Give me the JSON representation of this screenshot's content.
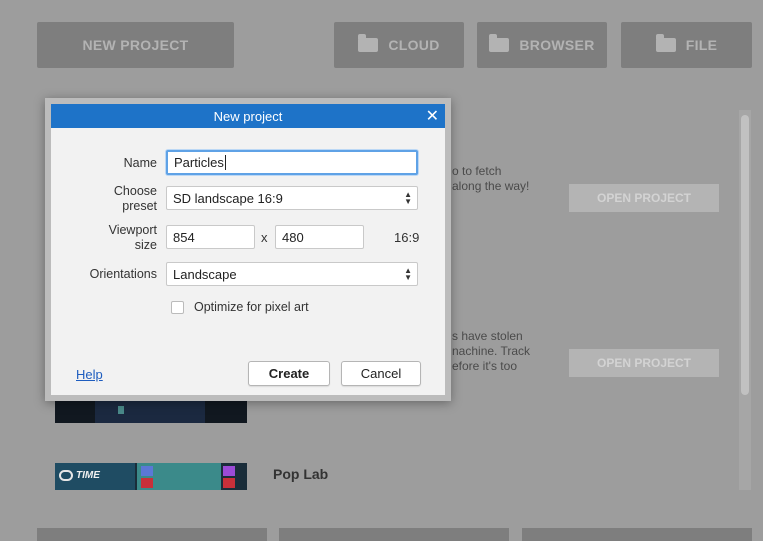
{
  "background": {
    "top_buttons": [
      {
        "label": "NEW PROJECT"
      },
      {
        "label": "CLOUD",
        "icon": "folder-icon"
      },
      {
        "label": "BROWSER",
        "icon": "folder-icon"
      },
      {
        "label": "FILE",
        "icon": "folder-icon"
      }
    ],
    "project1": {
      "desc_line1": "o to fetch",
      "desc_line2": "along the way!",
      "open_label": "OPEN PROJECT"
    },
    "project2": {
      "desc_line1": "s have stolen",
      "desc_line2": "nachine. Track",
      "desc_line3": "efore it's too",
      "open_label": "OPEN PROJECT"
    },
    "project3": {
      "title": "Pop Lab",
      "thumb_text": "TIME"
    }
  },
  "dialog": {
    "title": "New project",
    "name_label": "Name",
    "name_value": "Particles",
    "preset_label_line1": "Choose",
    "preset_label_line2": "preset",
    "preset_value": "SD landscape 16:9",
    "viewport_label_line1": "Viewport",
    "viewport_label_line2": "size",
    "width_value": "854",
    "by_label": "x",
    "height_value": "480",
    "aspect": "16:9",
    "orientation_label": "Orientations",
    "orientation_value": "Landscape",
    "pixel_art_label": "Optimize for pixel art",
    "help_label": "Help",
    "create_label": "Create",
    "cancel_label": "Cancel"
  },
  "colors": {
    "titlebar": "#1e73c8",
    "link": "#1e5dbf",
    "focus": "#5fa2e6"
  }
}
